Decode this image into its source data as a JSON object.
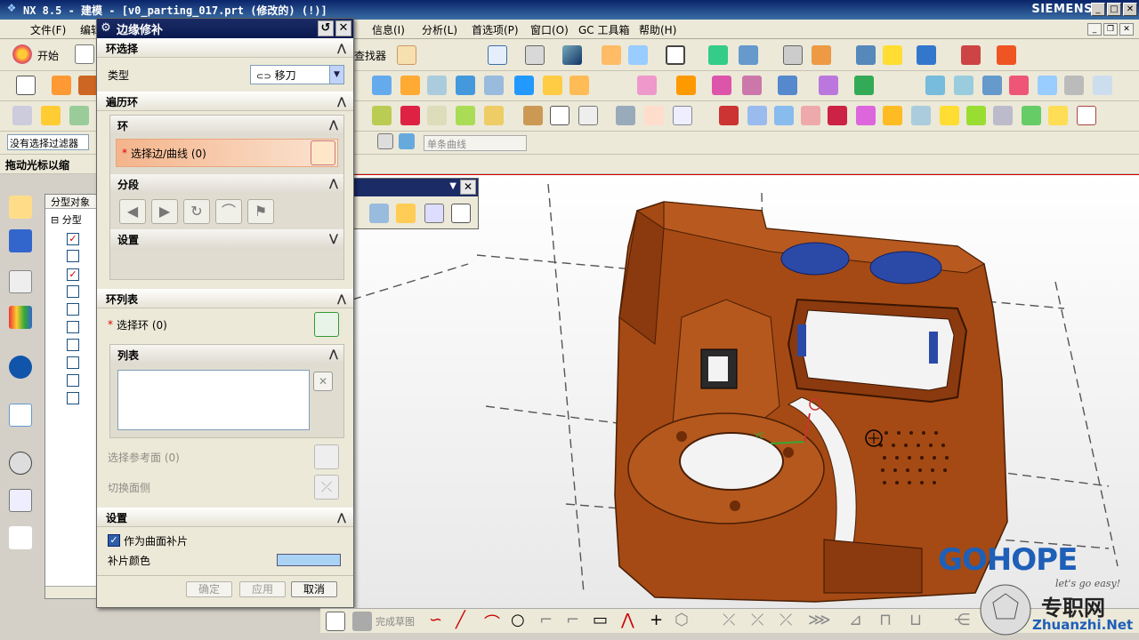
{
  "window": {
    "title": "NX 8.5 - 建模 - [v0_parting_017.prt (修改的) (!)]",
    "brand": "SIEMENS"
  },
  "menu": [
    {
      "label": "文件(F)"
    },
    {
      "label": "编辑"
    },
    {
      "label": "信息(I)"
    },
    {
      "label": "分析(L)"
    },
    {
      "label": "首选项(P)"
    },
    {
      "label": "窗口(O)"
    },
    {
      "label": "GC 工具箱"
    },
    {
      "label": "帮助(H)"
    }
  ],
  "toolbar": {
    "start_label": "开始",
    "finder_label": "查找器",
    "filter_value": "没有选择过滤器",
    "curve_filter_value": "单条曲线",
    "drag_label": "拖动光标以缩"
  },
  "navigator": {
    "header": "分型对象",
    "root_label": "分型"
  },
  "dialog": {
    "title": "边缘修补",
    "loop_select": {
      "header": "环选择",
      "type_label": "类型",
      "type_value": "移刀"
    },
    "traverse_loop": {
      "header": "遍历环",
      "loop_group": {
        "header": "环",
        "select_label": "选择边/曲线 (0)"
      },
      "segment_group": {
        "header": "分段"
      },
      "settings_group": {
        "header": "设置"
      }
    },
    "loop_list": {
      "header": "环列表",
      "select_label": "选择环 (0)",
      "list_header": "列表",
      "ref_face_label": "选择参考面 (0)",
      "flip_label": "切换面侧"
    },
    "settings": {
      "header": "设置",
      "as_patch_label": "作为曲面补片",
      "as_patch_checked": true,
      "patch_color_label": "补片颜色",
      "patch_color": "#a9d2f5"
    },
    "buttons": {
      "ok": "确定",
      "apply": "应用",
      "cancel": "取消"
    }
  },
  "bottombar": {
    "finish_sketch_label": "完成草图"
  },
  "watermark": {
    "logo": "GOHOPE",
    "site_cn": "专职网",
    "site_url": "Zhuanzhi.Net",
    "slogan": "let's go easy!"
  },
  "colors": {
    "part": "#a54a14",
    "part_dark": "#6e2c08",
    "hole_blue": "#2b4aa8",
    "accent": "#0a246a"
  }
}
